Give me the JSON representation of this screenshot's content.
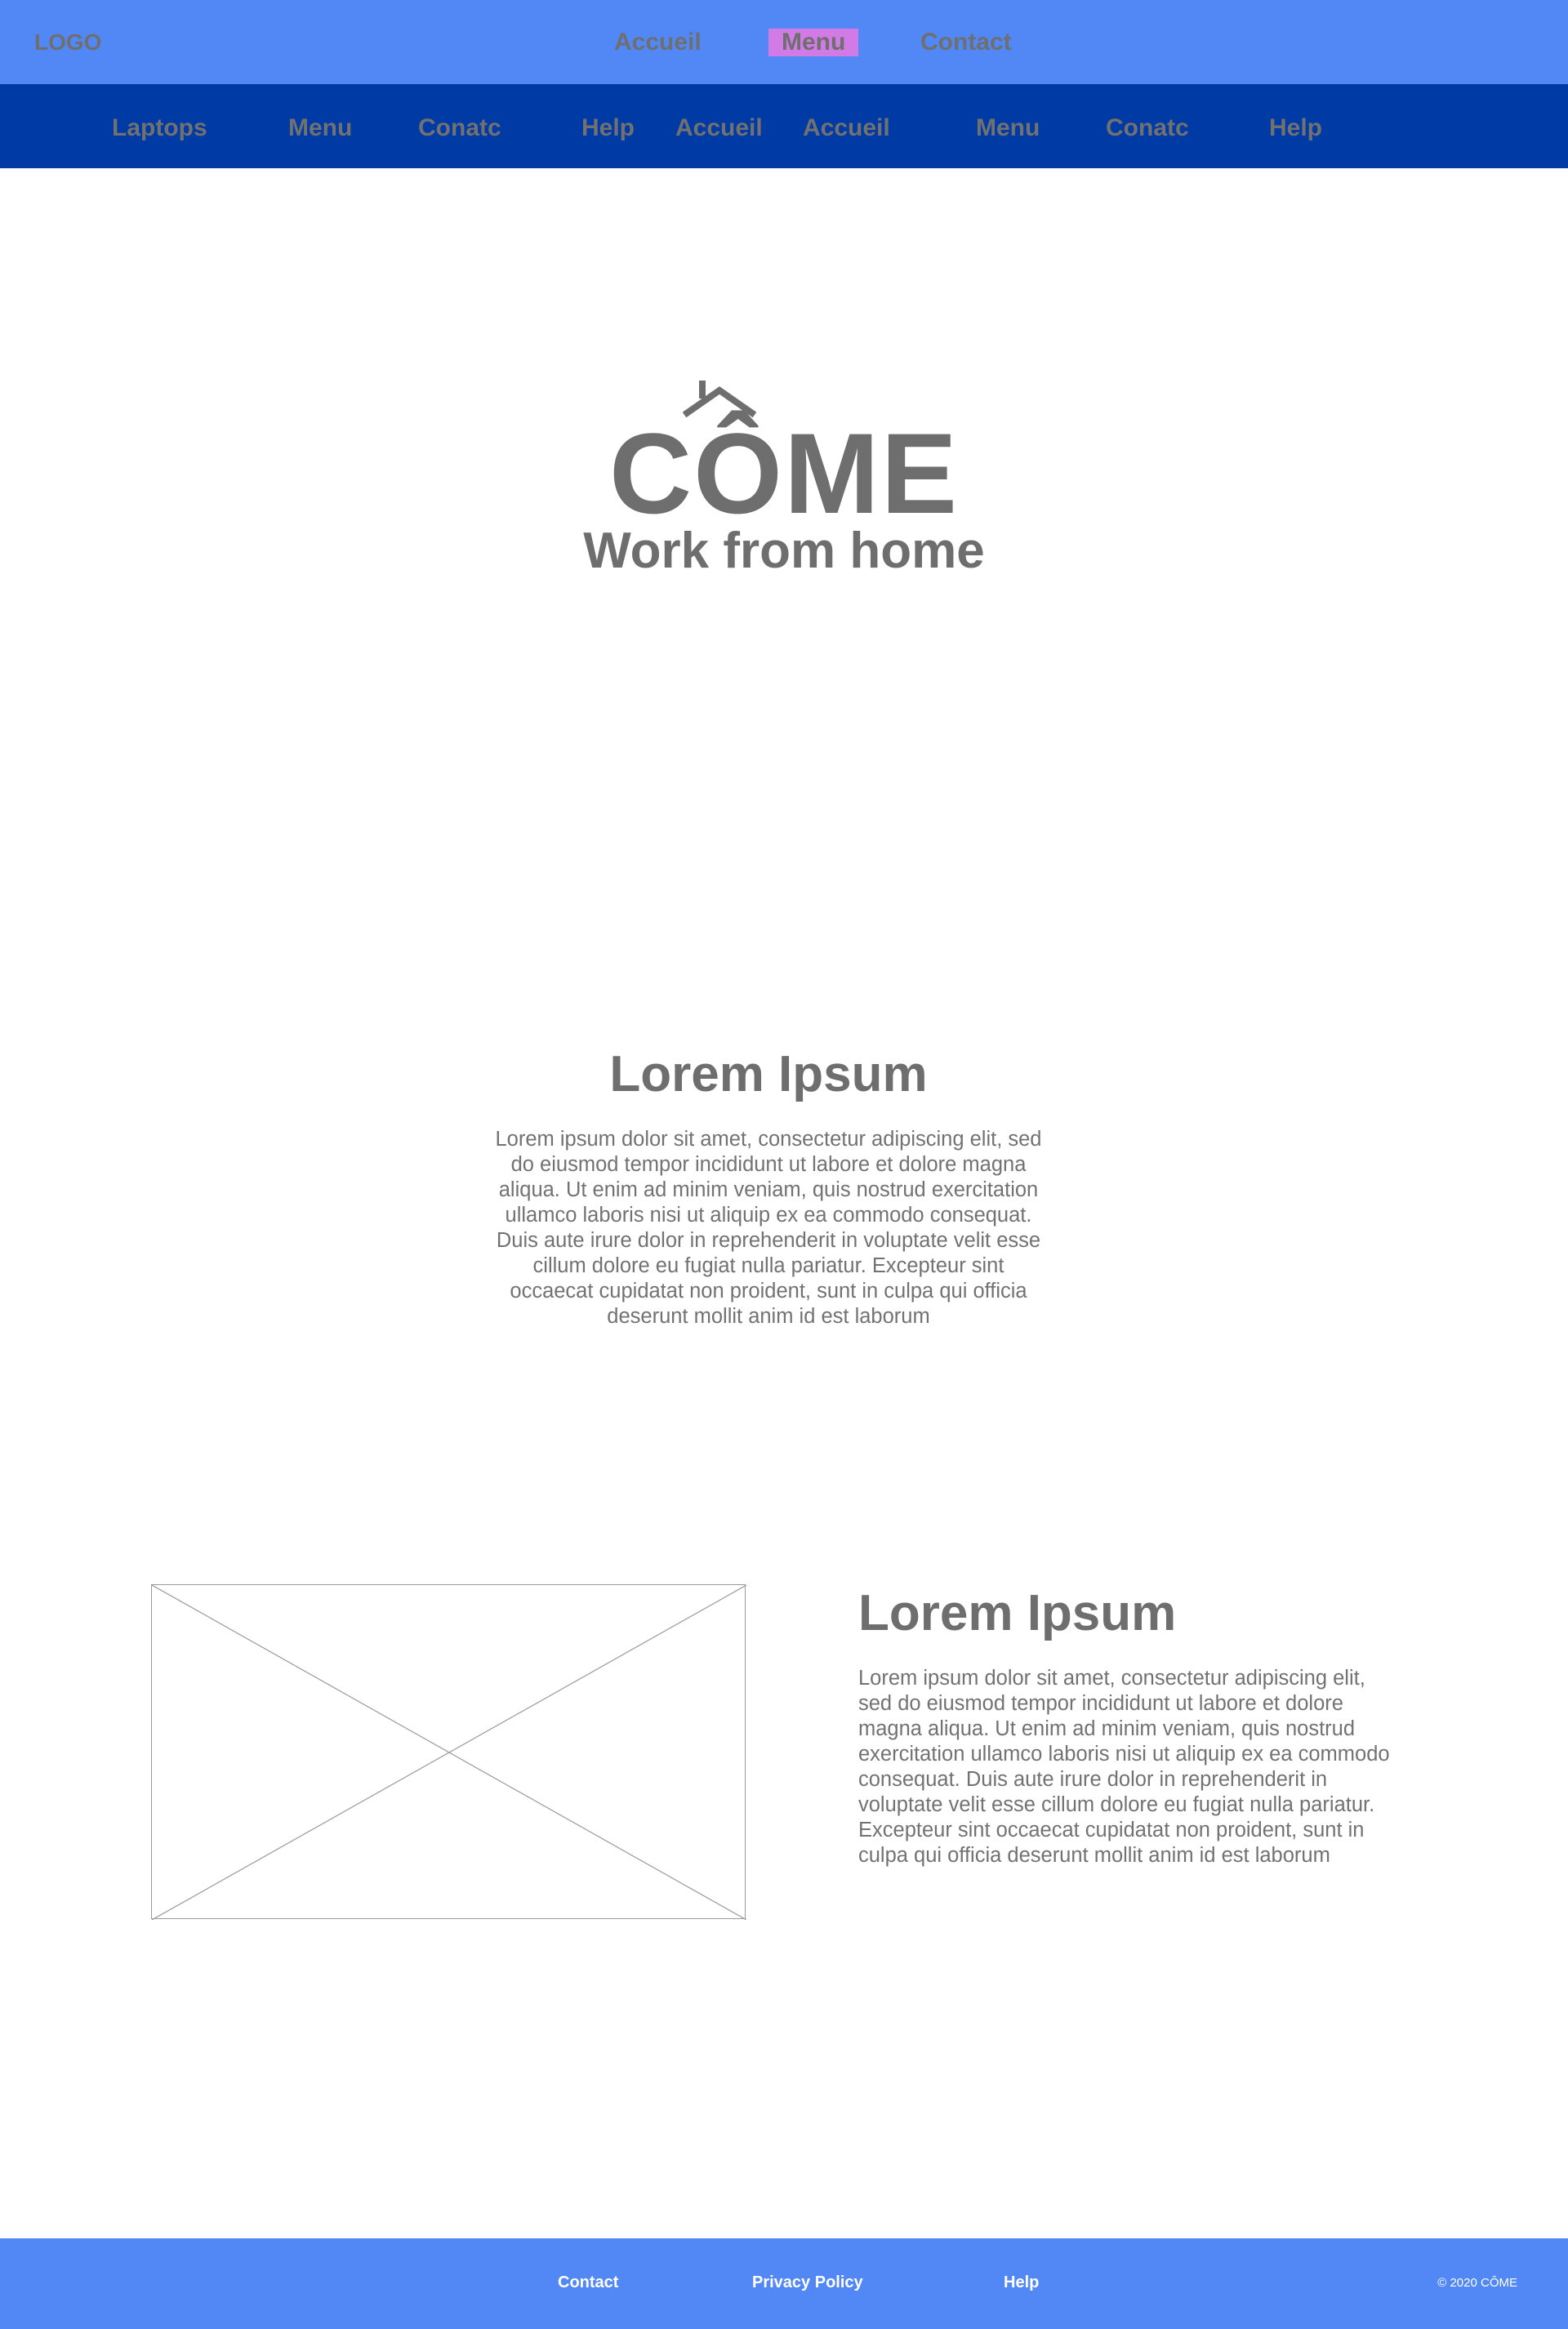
{
  "colors": {
    "header_bg": "#5188f5",
    "subnav_bg": "#003aa5",
    "active_nav_bg": "#d27ae6",
    "text_gray": "#707070",
    "footer_text": "#ffffff"
  },
  "header": {
    "logo": "LOGO",
    "nav": [
      {
        "label": "Accueil"
      },
      {
        "label": "Menu",
        "active": true
      },
      {
        "label": "Contact"
      }
    ]
  },
  "subnav": {
    "items": [
      "Laptops",
      "Menu",
      "Conatc",
      "Help",
      "Accueil",
      "Accueil",
      "Menu",
      "Conatc",
      "Help"
    ]
  },
  "hero": {
    "brand": "CÔME",
    "roof_icon": "house-roof-icon",
    "tagline": "Work from home"
  },
  "section1": {
    "title": "Lorem Ipsum",
    "body": "Lorem ipsum dolor sit amet, consectetur adipiscing elit, sed do eiusmod tempor incididunt ut labore et dolore magna aliqua. Ut enim ad minim veniam, quis nostrud exercitation ullamco laboris nisi ut aliquip ex ea commodo consequat. Duis aute irure dolor in reprehenderit in voluptate velit esse cillum dolore eu fugiat nulla pariatur. Excepteur sint occaecat cupidatat non proident, sunt in culpa qui officia deserunt mollit anim id est laborum"
  },
  "section2": {
    "image_icon": "image-placeholder-icon",
    "title": "Lorem Ipsum",
    "body": "Lorem ipsum dolor sit amet, consectetur adipiscing elit, sed do eiusmod tempor incididunt ut labore et dolore magna aliqua. Ut enim ad minim veniam, quis nostrud exercitation ullamco laboris nisi ut aliquip ex ea commodo consequat. Duis aute irure dolor in reprehenderit in voluptate velit esse cillum dolore eu fugiat nulla pariatur. Excepteur sint occaecat cupidatat non proident, sunt in culpa qui officia deserunt mollit anim id est laborum"
  },
  "footer": {
    "links": [
      "Contact",
      "Privacy Policy",
      "Help"
    ],
    "copyright": "© 2020 CÔME"
  }
}
